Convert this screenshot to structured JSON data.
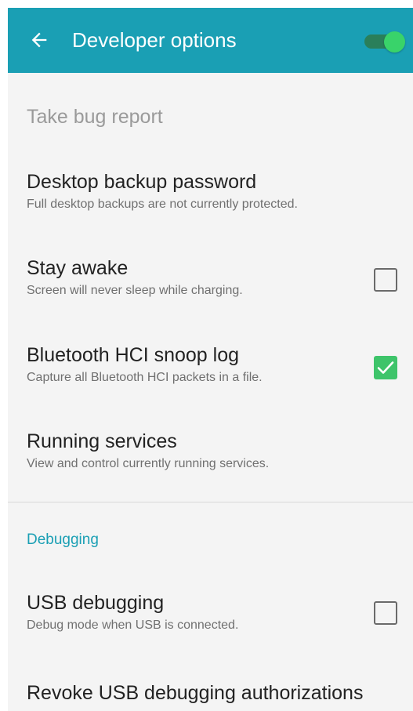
{
  "app_bar": {
    "title": "Developer options",
    "back_icon": "arrow-left-icon",
    "master_switch_on": true,
    "background_color": "#1a9fb4",
    "switch_color": "#39d36a"
  },
  "items": [
    {
      "title": "Take bug report",
      "enabled": false
    },
    {
      "title": "Desktop backup password",
      "summary": "Full desktop backups are not currently protected."
    },
    {
      "title": "Stay awake",
      "summary": "Screen will never sleep while charging.",
      "checked": false
    },
    {
      "title": "Bluetooth HCI snoop log",
      "summary": "Capture all Bluetooth HCI packets in a file.",
      "checked": true
    },
    {
      "title": "Running services",
      "summary": "View and control currently running services."
    }
  ],
  "debugging_section": {
    "header": "Debugging",
    "items": [
      {
        "title": "USB debugging",
        "summary": "Debug mode when USB is connected.",
        "checked": false
      },
      {
        "title": "Revoke USB debugging authorizations"
      }
    ]
  }
}
